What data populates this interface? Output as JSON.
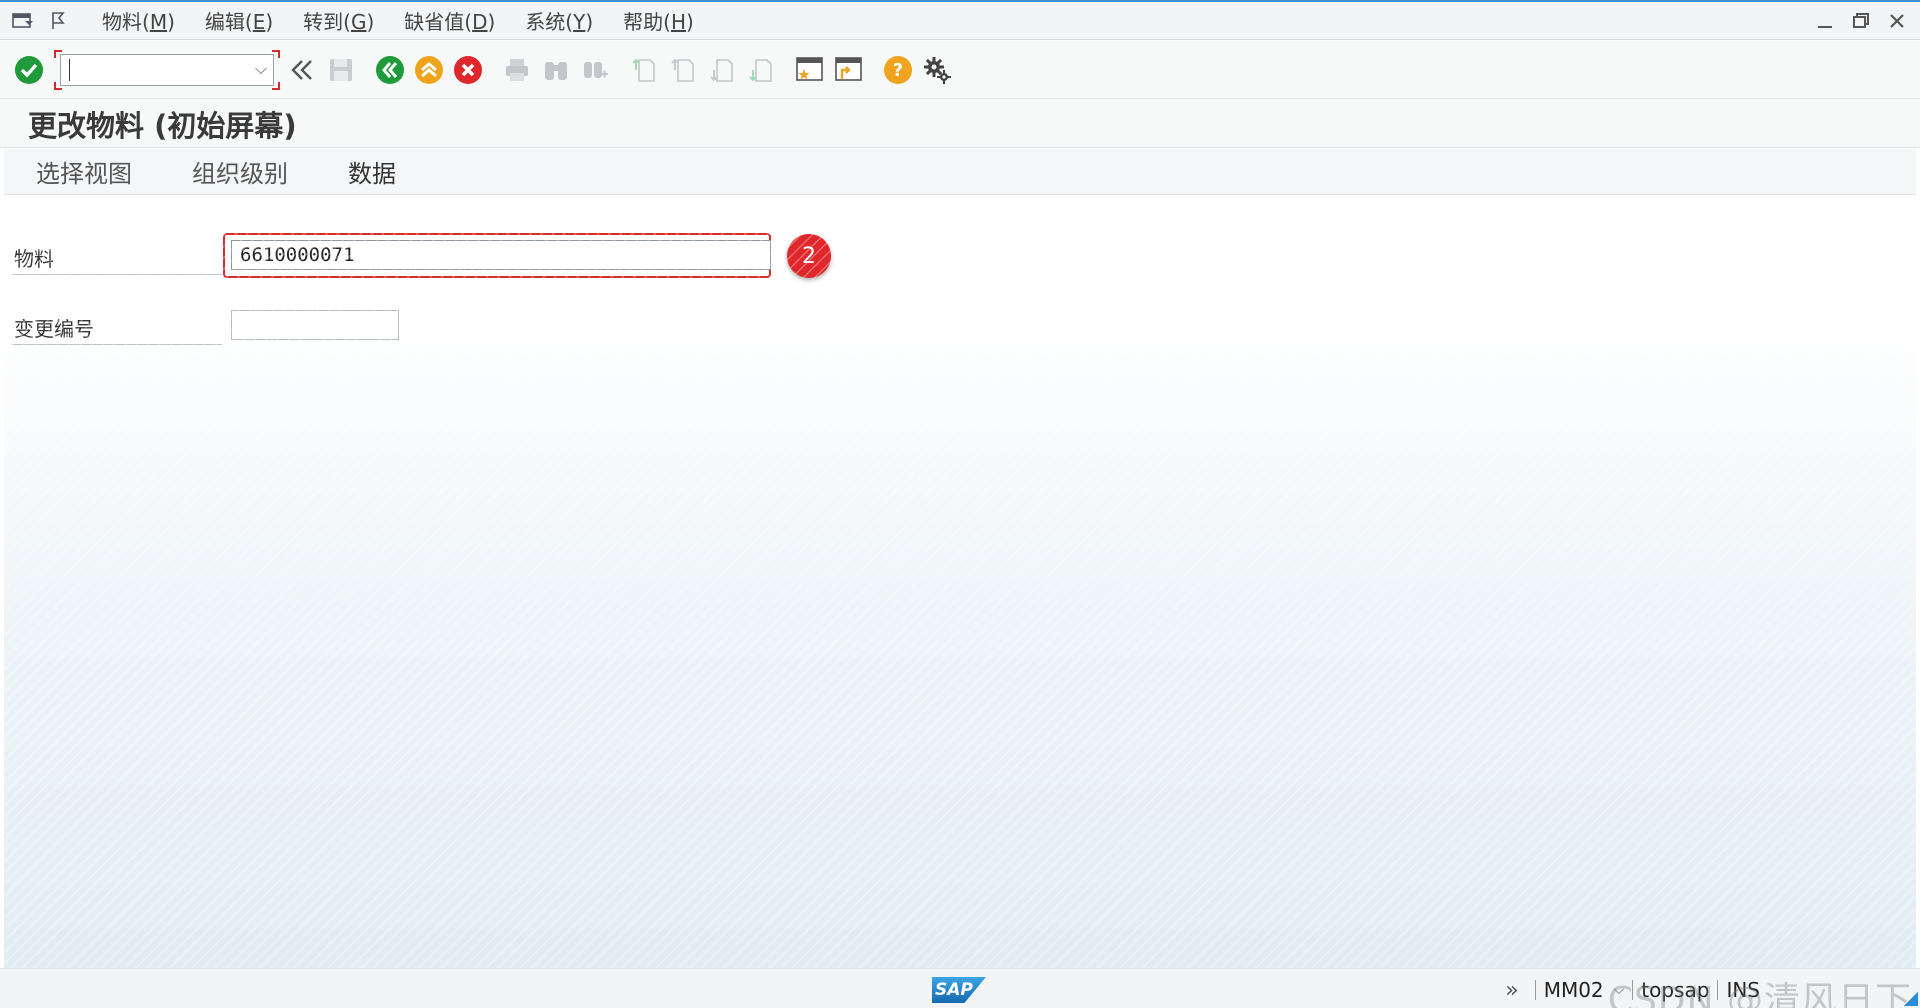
{
  "menubar": {
    "items": [
      {
        "label": "物料(",
        "key": "M",
        "suffix": ")"
      },
      {
        "label": "编辑(",
        "key": "E",
        "suffix": ")"
      },
      {
        "label": "转到(",
        "key": "G",
        "suffix": ")"
      },
      {
        "label": "缺省值(",
        "key": "D",
        "suffix": ")"
      },
      {
        "label": "系统(",
        "key": "Y",
        "suffix": ")"
      },
      {
        "label": "帮助(",
        "key": "H",
        "suffix": ")"
      }
    ]
  },
  "toolbar": {
    "command_value": ""
  },
  "page": {
    "title": "更改物料 (初始屏幕)"
  },
  "app_toolbar": {
    "buttons": [
      "选择视图",
      "组织级别",
      "数据"
    ]
  },
  "form": {
    "material_label": "物料",
    "material_value": "6610000071",
    "change_number_label": "变更编号",
    "change_number_value": "",
    "step_badge": "2"
  },
  "statusbar": {
    "transaction": "MM02",
    "system": "topsap",
    "mode": "INS",
    "watermark": "CSDN @清风日下"
  },
  "colors": {
    "accent": "#3b8fd6",
    "highlight": "#d62b2b",
    "ok_green": "#1e9a3a",
    "warn_orange": "#f0a31c",
    "cancel_red": "#e0272b"
  }
}
